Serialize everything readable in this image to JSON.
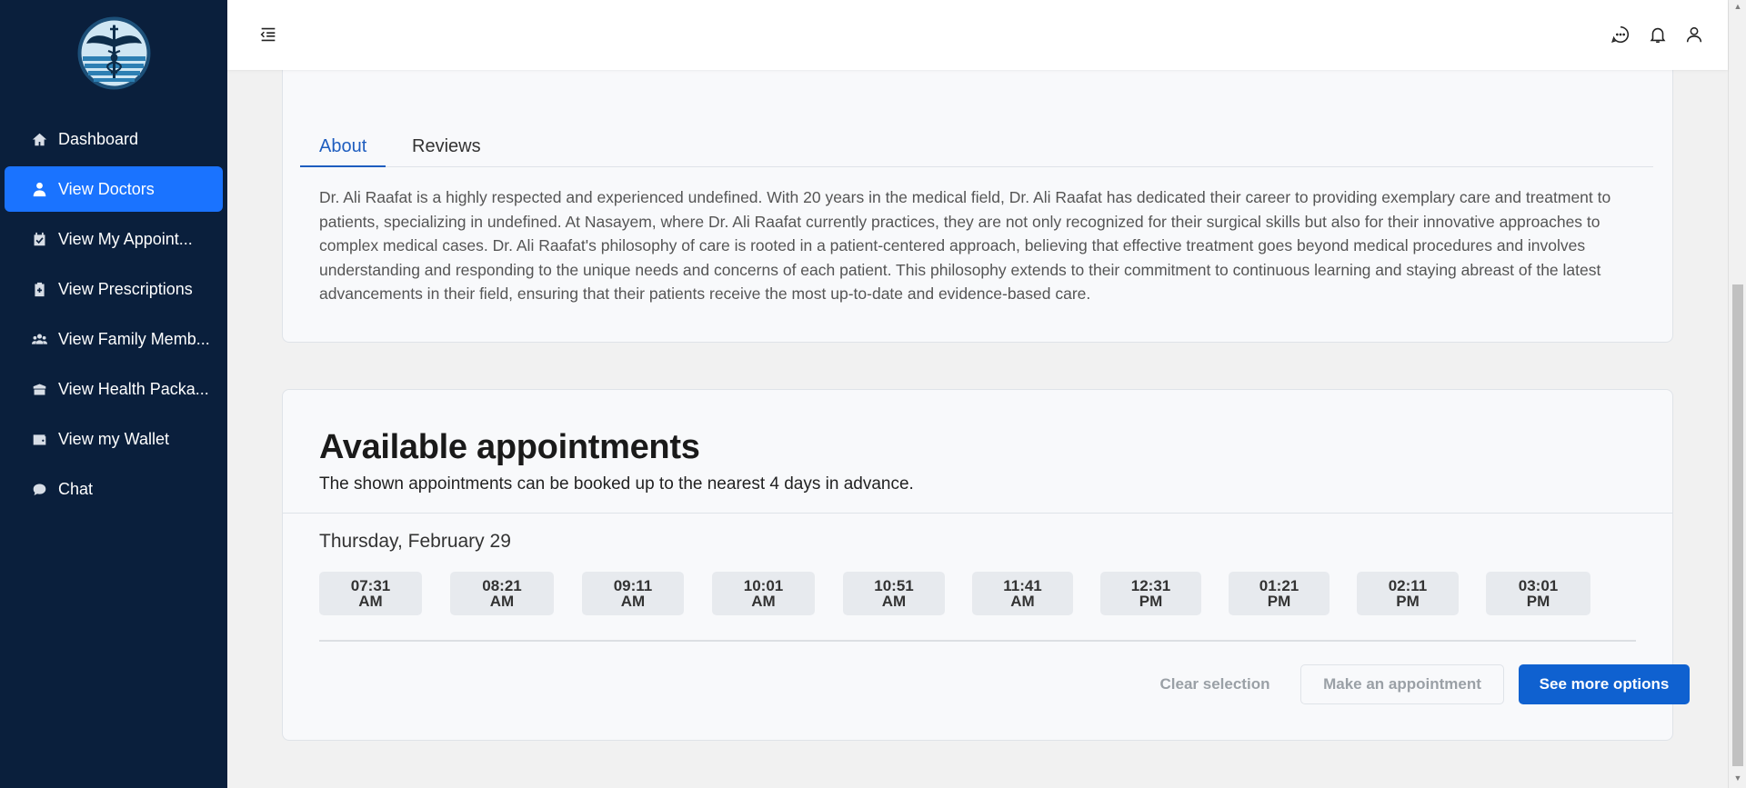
{
  "sidebar": {
    "items": [
      {
        "label": "Dashboard",
        "icon": "home-icon",
        "active": false
      },
      {
        "label": "View Doctors",
        "icon": "doctor-icon",
        "active": true
      },
      {
        "label": "View My Appoint...",
        "icon": "calendar-check-icon",
        "active": false
      },
      {
        "label": "View Prescriptions",
        "icon": "prescription-icon",
        "active": false
      },
      {
        "label": "View Family Memb...",
        "icon": "users-icon",
        "active": false
      },
      {
        "label": "View Health Packa...",
        "icon": "box-icon",
        "active": false
      },
      {
        "label": "View my Wallet",
        "icon": "wallet-icon",
        "active": false
      },
      {
        "label": "Chat",
        "icon": "chat-icon",
        "active": false
      }
    ]
  },
  "header": {
    "menu_icon": "menu-collapse-icon",
    "right_icons": [
      "chat-bubble-icon",
      "bell-icon",
      "user-icon"
    ]
  },
  "about": {
    "tabs": [
      {
        "label": "About",
        "active": true
      },
      {
        "label": "Reviews",
        "active": false
      }
    ],
    "text": "Dr. Ali Raafat is a highly respected and experienced undefined. With 20 years in the medical field, Dr. Ali Raafat has dedicated their career to providing exemplary care and treatment to patients, specializing in undefined. At Nasayem, where Dr. Ali Raafat currently practices, they are not only recognized for their surgical skills but also for their innovative approaches to complex medical cases. Dr. Ali Raafat's philosophy of care is rooted in a patient-centered approach, believing that effective treatment goes beyond medical procedures and involves understanding and responding to the unique needs and concerns of each patient. This philosophy extends to their commitment to continuous learning and staying abreast of the latest advancements in their field, ensuring that their patients receive the most up-to-date and evidence-based care."
  },
  "appointments": {
    "title": "Available appointments",
    "subtitle": "The shown appointments can be booked up to the nearest 4 days in advance.",
    "day": "Thursday, February 29",
    "slots": [
      {
        "time": "07:31",
        "period": "AM"
      },
      {
        "time": "08:21",
        "period": "AM"
      },
      {
        "time": "09:11",
        "period": "AM"
      },
      {
        "time": "10:01",
        "period": "AM"
      },
      {
        "time": "10:51",
        "period": "AM"
      },
      {
        "time": "11:41",
        "period": "AM"
      },
      {
        "time": "12:31",
        "period": "PM"
      },
      {
        "time": "01:21",
        "period": "PM"
      },
      {
        "time": "02:11",
        "period": "PM"
      },
      {
        "time": "03:01",
        "period": "PM"
      }
    ],
    "buttons": {
      "clear": "Clear selection",
      "make": "Make an appointment",
      "more": "See more options"
    }
  },
  "colors": {
    "sidebar_bg": "#0a1f3c",
    "active_nav": "#1a73ff",
    "primary_button": "#0f61d0",
    "tab_active": "#1e5dbf"
  }
}
